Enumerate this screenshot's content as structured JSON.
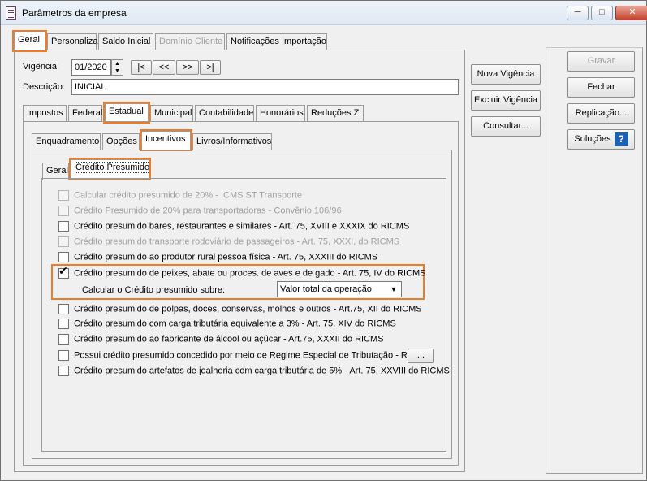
{
  "window": {
    "title": "Parâmetros da empresa"
  },
  "top_tabs": [
    "Geral",
    "Personaliza",
    "Saldo Inicial",
    "Domínio Cliente",
    "Notificações Importação"
  ],
  "vigencia": {
    "label": "Vigência:",
    "value": "01/2020",
    "nav": [
      "|<",
      "<<",
      ">>",
      ">|"
    ]
  },
  "descricao": {
    "label": "Descrição:",
    "value": "INICIAL"
  },
  "sub_tabs": [
    "Impostos",
    "Federal",
    "Estadual",
    "Municipal",
    "Contabilidade",
    "Honorários",
    "Reduções Z"
  ],
  "estadual_tabs": [
    "Enquadramento",
    "Opções",
    "Incentivos",
    "Livros/Informativos"
  ],
  "incentivos_tabs": [
    "Geral",
    "Crédito Presumido"
  ],
  "checks": [
    {
      "label": "Calcular crédito presumido de 20% - ICMS ST Transporte",
      "checked": false,
      "enabled": false
    },
    {
      "label": "Crédito Presumido de 20% para transportadoras - Convênio 106/96",
      "checked": false,
      "enabled": false
    },
    {
      "label": "Crédito presumido bares, restaurantes e similares - Art. 75, XVIII e XXXIX do RICMS",
      "checked": false,
      "enabled": true
    },
    {
      "label": "Crédito presumido transporte rodoviário de passageiros - Art. 75, XXXI, do RICMS",
      "checked": false,
      "enabled": false
    },
    {
      "label": "Crédito presumido ao produtor rural pessoa física - Art. 75, XXXIII do RICMS",
      "checked": false,
      "enabled": true
    },
    {
      "label": "Crédito presumido de peixes, abate ou proces. de aves e de gado - Art. 75, IV do RICMS",
      "checked": true,
      "enabled": true
    },
    {
      "label": "Crédito presumido de polpas, doces, conservas, molhos e outros - Art.75, XII do RICMS",
      "checked": false,
      "enabled": true
    },
    {
      "label": "Crédito presumido com carga tributária equivalente a 3% - Art. 75, XIV do RICMS",
      "checked": false,
      "enabled": true
    },
    {
      "label": "Crédito presumido ao fabricante de álcool ou açúcar - Art.75, XXXII do RICMS",
      "checked": false,
      "enabled": true
    },
    {
      "label": "Possui crédito presumido concedido por meio de Regime Especial de Tributação - RET",
      "checked": false,
      "enabled": true
    },
    {
      "label": "Crédito presumido artefatos de joalheria com carga tributária de 5% - Art. 75, XXVIII do RICMS",
      "checked": false,
      "enabled": true
    }
  ],
  "calc_sobre": {
    "label": "Calcular o Crédito presumido sobre:",
    "value": "Valor total da operação"
  },
  "ret_button": "...",
  "mid_buttons": [
    "Nova Vigência",
    "Excluir Vigência",
    "Consultar..."
  ],
  "right_buttons": [
    "Gravar",
    "Fechar",
    "Replicação...",
    "Soluções"
  ],
  "highlight_color": "#f07b26"
}
